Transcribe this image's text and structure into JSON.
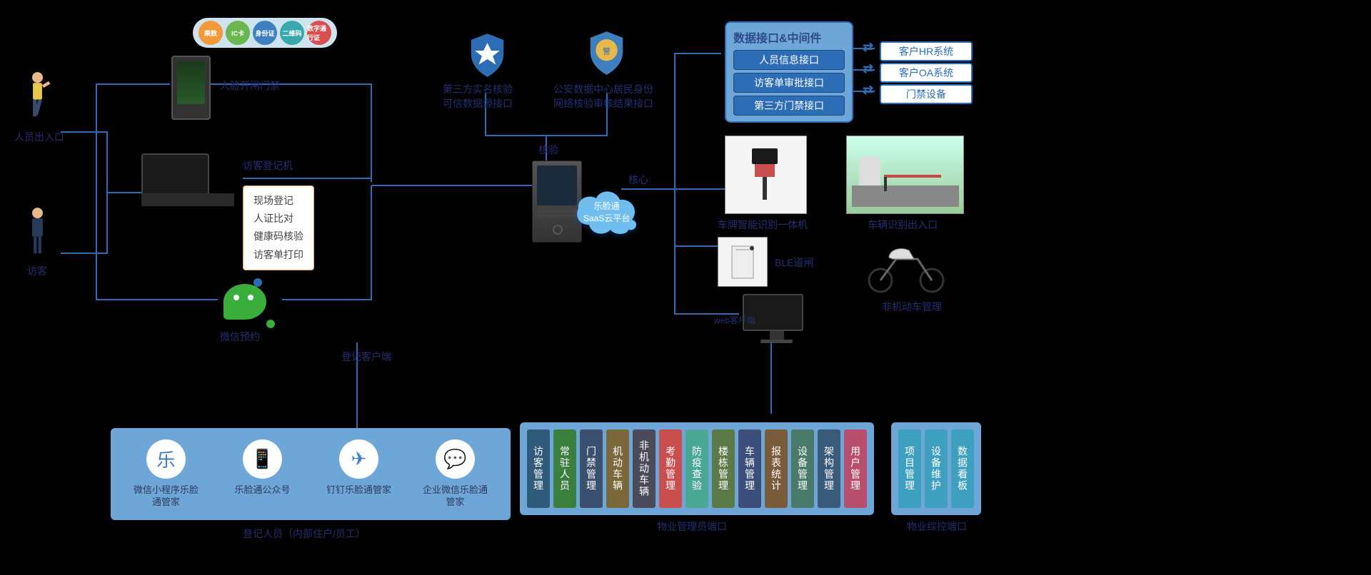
{
  "auth_pills": [
    "乘数",
    "IC卡",
    "身份证",
    "二维码",
    "数字通行证"
  ],
  "labels": {
    "person_entry": "人员出入口",
    "visitor": "访客",
    "face_gate": "人脸开闸门禁",
    "visitor_machine": "访客登记机",
    "wechat_appt": "微信预约",
    "reg_client": "登记客户端",
    "third_party": "第三方实名核验\n可信数据源接口",
    "police": "公安数据中心居民身份\n网络核验审核结果接口",
    "core": "核心",
    "verify": "核验",
    "cloud_name": "乐脸通",
    "cloud_sub": "SaaS云平台",
    "lpr": "车牌智能识别一体机",
    "vehicle_entry": "车辆识别出入口",
    "ble": "BLE道闸",
    "ebike": "非机动车管理",
    "web_client": "web客户端",
    "reg_staff": "登记人员（内部住户/员工）",
    "prop_mgmt": "物业管理员端口",
    "prop_ops": "物业综控端口"
  },
  "feature_box": [
    "现场登记",
    "人证比对",
    "健康码核验",
    "访客单打印"
  ],
  "api": {
    "title": "数据接口&中间件",
    "items": [
      "人员信息接口",
      "访客单审批接口",
      "第三方门禁接口"
    ]
  },
  "ext": [
    "客户HR系统",
    "客户OA系统",
    "门禁设备"
  ],
  "clients": [
    {
      "name": "微信小程序乐脸通管家",
      "icon": "乐"
    },
    {
      "name": "乐脸通公众号",
      "icon": "📱"
    },
    {
      "name": "钉钉乐脸通管家",
      "icon": "✈"
    },
    {
      "name": "企业微信乐脸通管家",
      "icon": "💬"
    }
  ],
  "mgmt": [
    {
      "t": "访客管理",
      "c": "#2F5A7A"
    },
    {
      "t": "常驻人员",
      "c": "#3A7F3E"
    },
    {
      "t": "门禁管理",
      "c": "#3B4F6F"
    },
    {
      "t": "机动车辆",
      "c": "#7A673A"
    },
    {
      "t": "非机动车辆",
      "c": "#4A4A5A"
    },
    {
      "t": "考勤管理",
      "c": "#C94E4E"
    },
    {
      "t": "防疫查验",
      "c": "#4AA894"
    },
    {
      "t": "楼栋管理",
      "c": "#5B7A48"
    },
    {
      "t": "车辆管理",
      "c": "#3B4F7A"
    },
    {
      "t": "报表统计",
      "c": "#7A5B3A"
    },
    {
      "t": "设备管理",
      "c": "#4A7A6A"
    },
    {
      "t": "架构管理",
      "c": "#3A5A7A"
    },
    {
      "t": "用户管理",
      "c": "#B84E6E"
    }
  ],
  "ops": [
    {
      "t": "项目管理",
      "c": "#3F9FBE"
    },
    {
      "t": "设备维护",
      "c": "#3F9FBE"
    },
    {
      "t": "数据看板",
      "c": "#3F9FBE"
    }
  ]
}
